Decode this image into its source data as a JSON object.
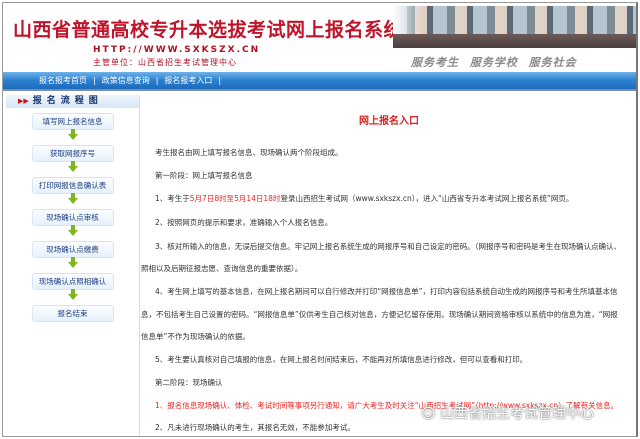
{
  "header": {
    "title": "山西省普通高校专升本选拔考试网上报名系统",
    "url": "HTTP://WWW.SXKSZX.CN",
    "org": "主管单位：山西省招生考试管理中心",
    "slogan": "服务考生 服务学校 服务社会"
  },
  "nav": {
    "items": [
      "报名报考首页",
      "政策信息查询",
      "报名报考入口"
    ],
    "separator": "|"
  },
  "sidebar": {
    "heading": "报名流程图",
    "steps": [
      "填写网上报名信息",
      "获取网报序号",
      "打印网报信息确认表",
      "现场确认点审核",
      "现场确认点缴费",
      "现场确认点照相确认",
      "报名结束"
    ]
  },
  "content": {
    "title": "网上报名入口",
    "intro": "考生报名由网上填写报名信息、现场确认两个阶段组成。",
    "stage1": "第一阶段：网上填写报名信息",
    "s1_1a": "1、考生于",
    "s1_1red": "5月7日8时至5月14日18时",
    "s1_1b": "登录山西招生考试网（www.sxkszx.cn），进入“山西省专升本考试网上报名系统”网页。",
    "s1_2": "2、按照网页的提示和要求，准确输入个人报名信息。",
    "s1_3a": "3、核对所输入的信息，无误后提交信息。牢记网上报名系统生成的网报序号和自己设定的密码。（网报序号和密码是考生在现场确认点确认、",
    "s1_3b": "照相以及后期征报志愿、查询信息的重要依据）。",
    "s1_4a": "4、考生网上填写的基本信息，在网上报名期间可以自行修改并打印“网报信息单”，打印内容包括系统自动生成的网报序号和考生所填基本信",
    "s1_4b": "息，不包括考生自己设置的密码。“网报信息单”仅供考生自己核对信息，方便记忆留存使用。现场确认期间资格审核以系统中的信息为准，“网报",
    "s1_4c": "信息单”不作为现场确认的依据。",
    "s1_5": "5、考生要认真核对自己填报的信息，在网上报名时间结束后，不能再对所填信息进行修改，但可以查看和打印。",
    "stage2": "第二阶段：现场确认",
    "s2_1": "1、报名信息现场确认、体检、考试时间等事项另行通知，请广大考生及时关注“山西招生考试网”（http://www.sxkszx.cn）了解有关信息。",
    "s2_2": "2、凡未进行现场确认的考生，其报名无效，不能参加考试。"
  },
  "watermark": "山西省招生考试管理中心",
  "colors": {
    "accent_red": "#e02020",
    "nav_blue": "#2a7fd0",
    "step_text": "#1c3f80",
    "arrow_green": "#7ab81e"
  }
}
